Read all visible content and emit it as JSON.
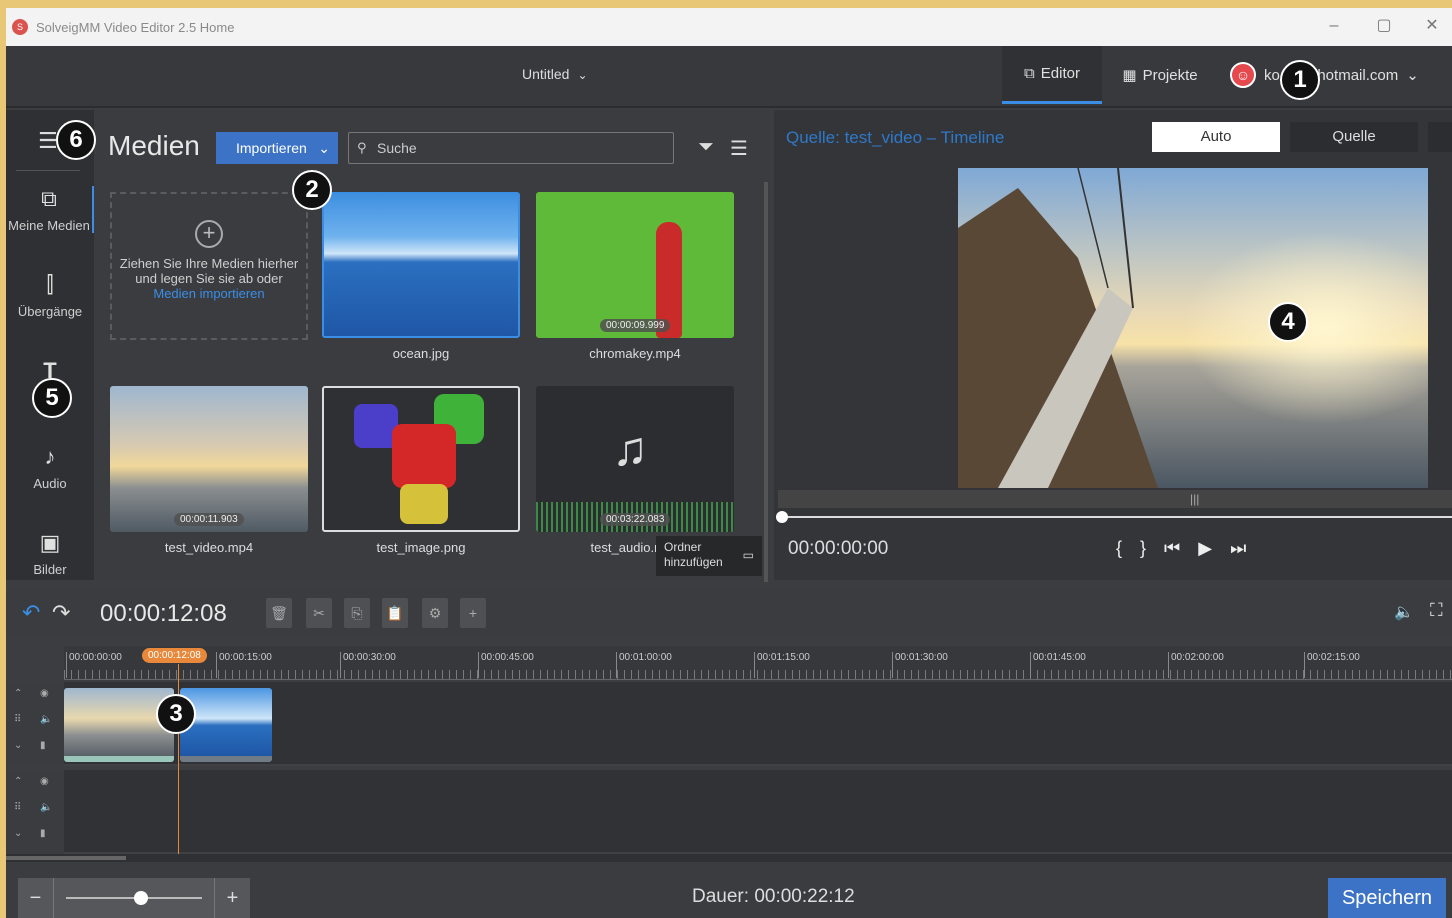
{
  "window": {
    "title": "SolveigMM Video Editor 2.5 Home",
    "minimize": "–",
    "maximize": "▢",
    "close": "✕"
  },
  "topbar": {
    "project_title": "Untitled",
    "tab_editor": "Editor",
    "tab_projekte": "Projekte",
    "account": "ko     hotmail.com"
  },
  "sidebar": {
    "items": [
      {
        "label": "Meine Medien",
        "icon": "my-media-icon"
      },
      {
        "label": "Übergänge",
        "icon": "transitions-icon"
      },
      {
        "label": "",
        "icon": "text-icon"
      },
      {
        "label": "Audio",
        "icon": "audio-icon"
      },
      {
        "label": "Bilder",
        "icon": "image-icon"
      }
    ]
  },
  "media": {
    "title": "Medien",
    "import_label": "Importieren",
    "search_placeholder": "Suche",
    "dropzone_text": "Ziehen Sie Ihre Medien hierher und legen Sie sie ab oder",
    "dropzone_link": "Medien importieren",
    "items": [
      {
        "name": "ocean.jpg",
        "duration": ""
      },
      {
        "name": "chromakey.mp4",
        "duration": "00:00:09.999"
      },
      {
        "name": "test_video.mp4",
        "duration": "00:00:11.903"
      },
      {
        "name": "test_image.png",
        "duration": ""
      },
      {
        "name": "test_audio.mp3",
        "duration": "00:03:22.083"
      }
    ],
    "tooltip": "Ordner hinzufügen"
  },
  "preview": {
    "title": "Quelle: test_video – Timeline",
    "tab_auto": "Auto",
    "tab_quelle": "Quelle",
    "time": "00:00:00:00"
  },
  "timeline": {
    "current_time": "00:00:12:08",
    "playhead_label": "00:00:12:08",
    "ticks": [
      "00:00:00:00",
      "00:00:15:00",
      "00:00:30:00",
      "00:00:45:00",
      "00:01:00:00",
      "00:01:15:00",
      "00:01:30:00",
      "00:01:45:00",
      "00:02:00:00",
      "00:02:15:00"
    ]
  },
  "footer": {
    "dauer_label": "Dauer:",
    "dauer_value": "00:00:22:12",
    "save_label": "Speichern",
    "zoom_level": 0.55
  },
  "callouts": [
    "1",
    "2",
    "3",
    "4",
    "5",
    "6"
  ],
  "colors": {
    "accent": "#3a8ee6",
    "button": "#3d73c7",
    "playhead": "#e8883a",
    "panel": "#3a3c3f"
  }
}
